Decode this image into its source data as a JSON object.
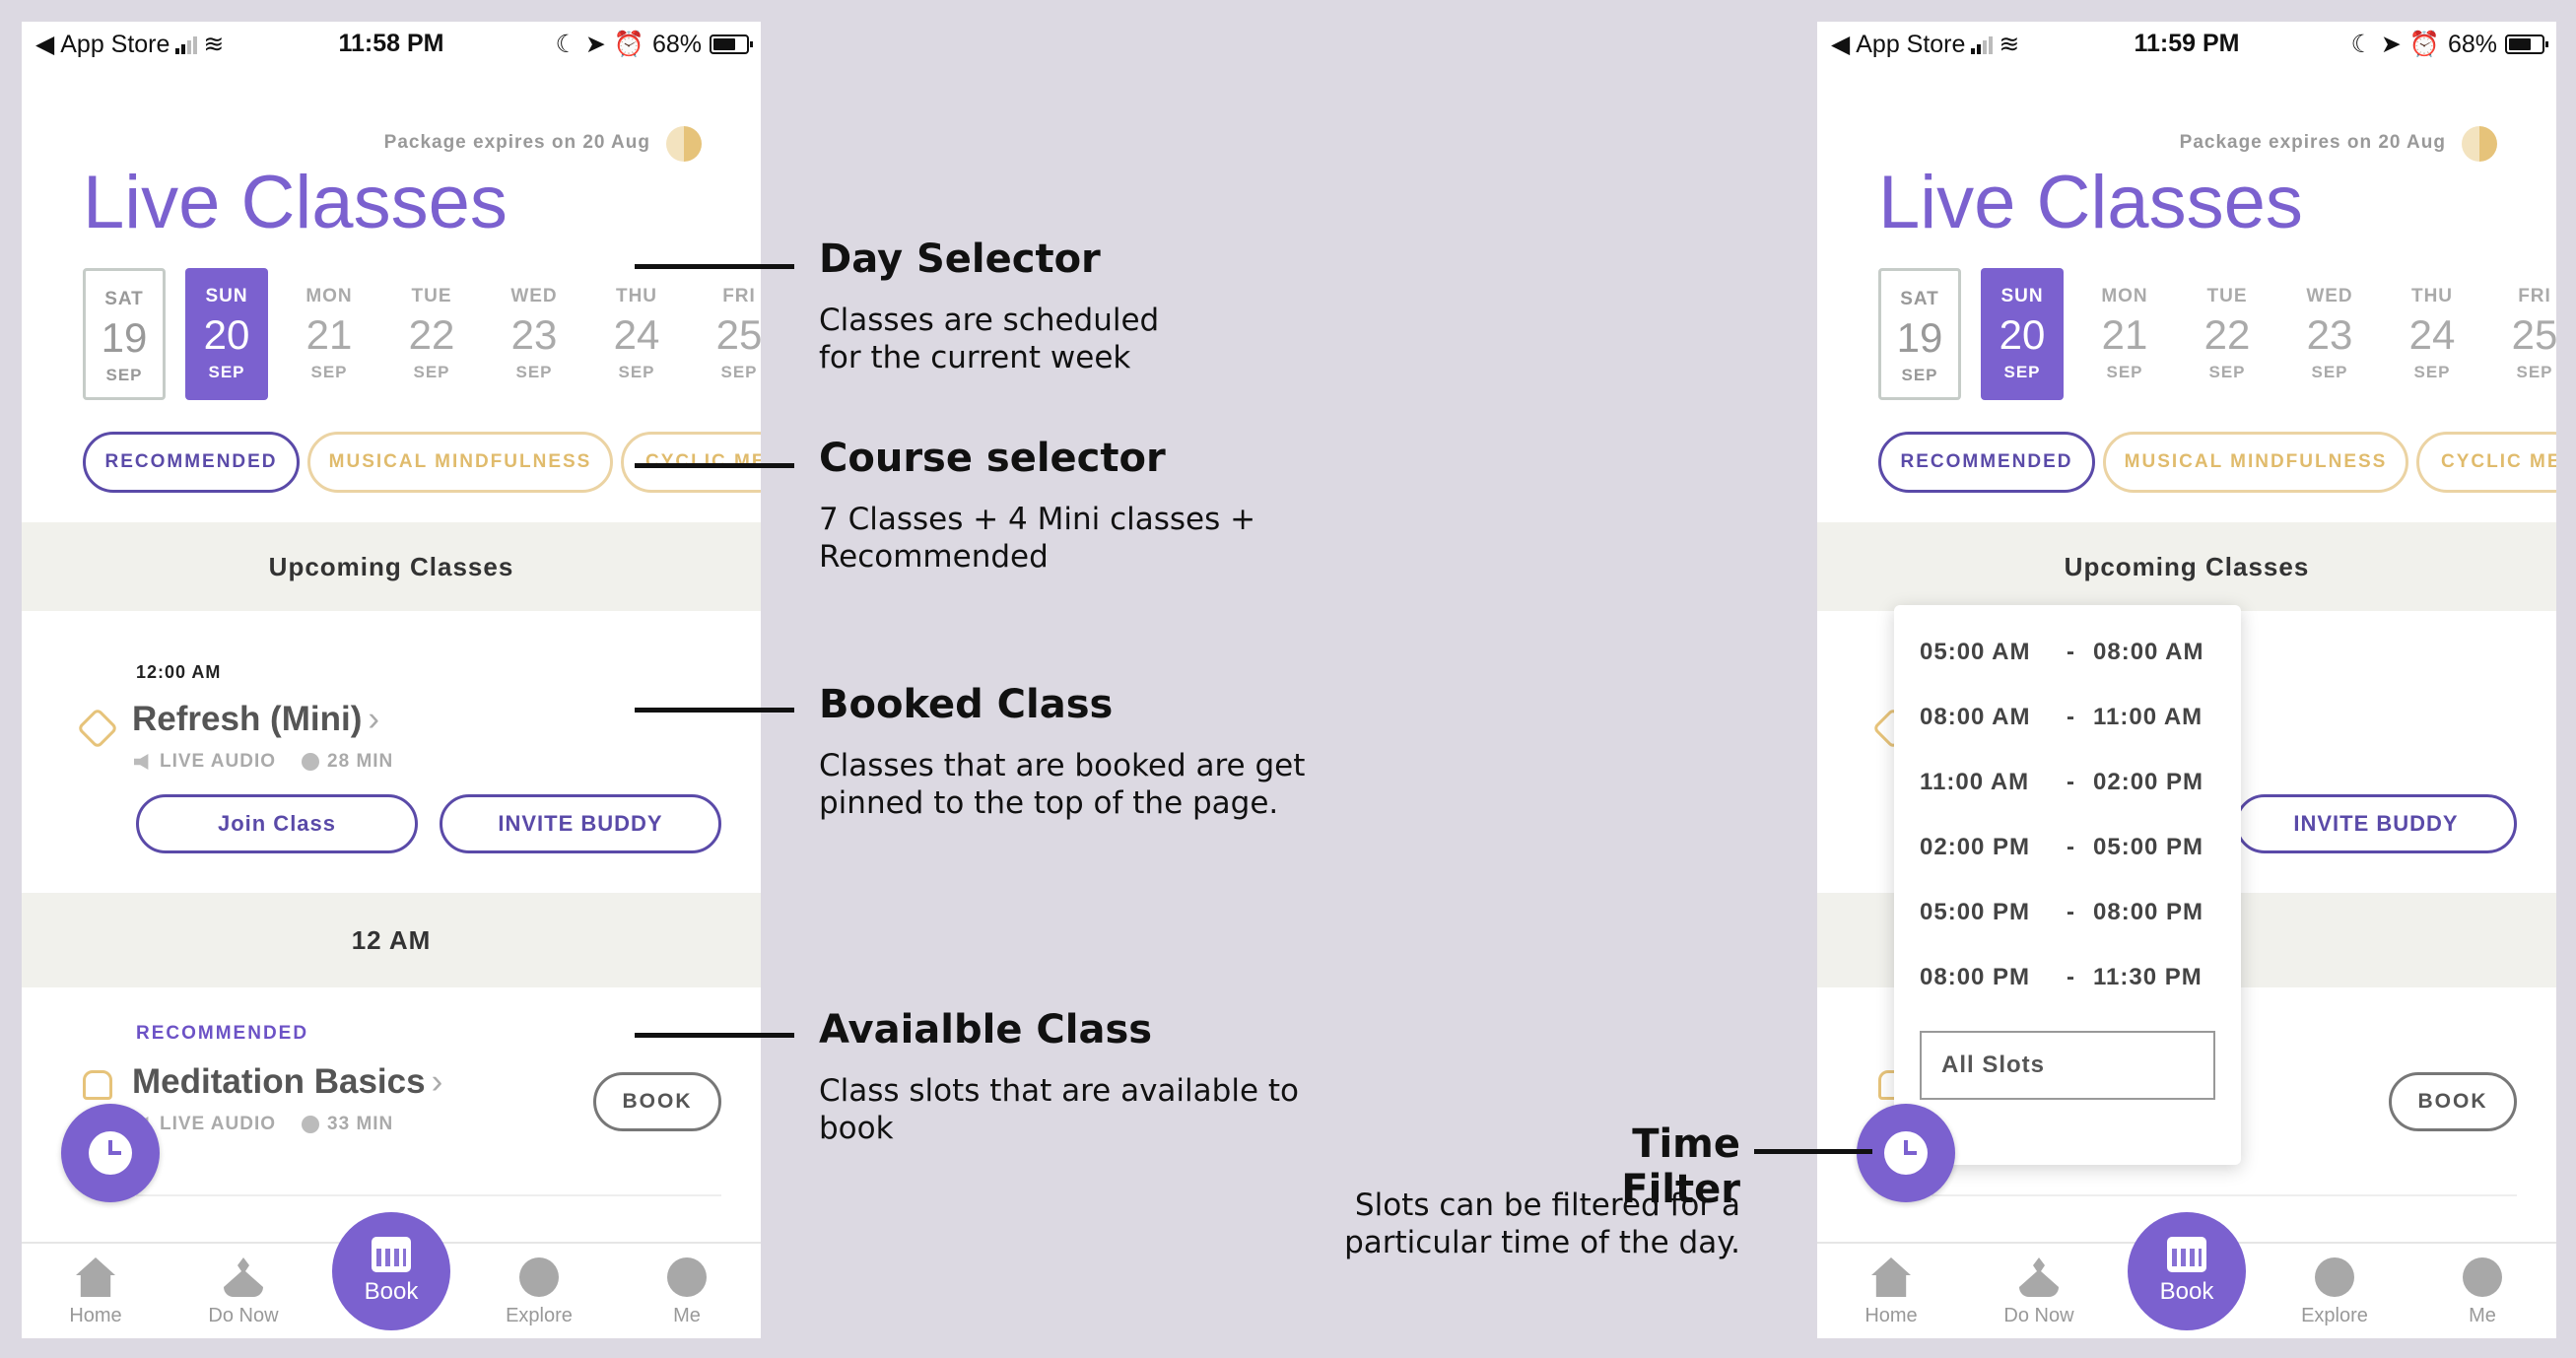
{
  "status": {
    "carrier": "App Store",
    "battery": "68%",
    "time_left": "11:58 PM",
    "time_right": "11:59 PM"
  },
  "header": {
    "package": "Package expires on 20 Aug",
    "title": "Live Classes"
  },
  "days": [
    {
      "dow": "SAT",
      "num": "19",
      "mon": "SEP"
    },
    {
      "dow": "SUN",
      "num": "20",
      "mon": "SEP"
    },
    {
      "dow": "MON",
      "num": "21",
      "mon": "SEP"
    },
    {
      "dow": "TUE",
      "num": "22",
      "mon": "SEP"
    },
    {
      "dow": "WED",
      "num": "23",
      "mon": "SEP"
    },
    {
      "dow": "THU",
      "num": "24",
      "mon": "SEP"
    },
    {
      "dow": "FRI",
      "num": "25",
      "mon": "SEP"
    }
  ],
  "courses": {
    "recommended": "RECOMMENDED",
    "musical": "MUSICAL MINDFULNESS",
    "cyclic": "CYCLIC ME"
  },
  "sections": {
    "upcoming": "Upcoming Classes",
    "slot_header": "12 AM"
  },
  "booked": {
    "time": "12:00 AM",
    "name": "Refresh (Mini)",
    "type": "LIVE AUDIO",
    "duration": "28 MIN",
    "join": "Join Class",
    "invite": "INVITE BUDDY"
  },
  "available": {
    "tag": "RECOMMENDED",
    "name": "Meditation Basics",
    "type": "LIVE AUDIO",
    "duration": "33 MIN",
    "book": "BOOK"
  },
  "tabs": {
    "home": "Home",
    "donow": "Do Now",
    "book": "Book",
    "explore": "Explore",
    "me": "Me"
  },
  "time_filter": {
    "slots": [
      {
        "from": "05:00 AM",
        "to": "08:00 AM"
      },
      {
        "from": "08:00 AM",
        "to": "11:00 AM"
      },
      {
        "from": "11:00 AM",
        "to": "02:00 PM"
      },
      {
        "from": "02:00 PM",
        "to": "05:00 PM"
      },
      {
        "from": "05:00 PM",
        "to": "08:00 PM"
      },
      {
        "from": "08:00 PM",
        "to": "11:30 PM"
      }
    ],
    "separator": "-",
    "all": "All Slots"
  },
  "annotations": {
    "day": {
      "title": "Day Selector",
      "desc": "Classes are scheduled\nfor the current week"
    },
    "course": {
      "title": "Course selector",
      "desc": "7 Classes + 4 Mini classes +\nRecommended"
    },
    "booked": {
      "title": "Booked Class",
      "desc": "Classes that are booked are get\npinned to the top of the page."
    },
    "available": {
      "title": "Avaialble Class",
      "desc": "Class slots that are available to\nbook"
    },
    "time": {
      "title": "Time Filter",
      "desc": "Slots can be filtered for a\nparticular time of the day."
    }
  },
  "colors": {
    "accent": "#7b61cf",
    "gold": "#e0bb6c",
    "band": "#f1f1ec",
    "background": "#dcd9e2"
  }
}
